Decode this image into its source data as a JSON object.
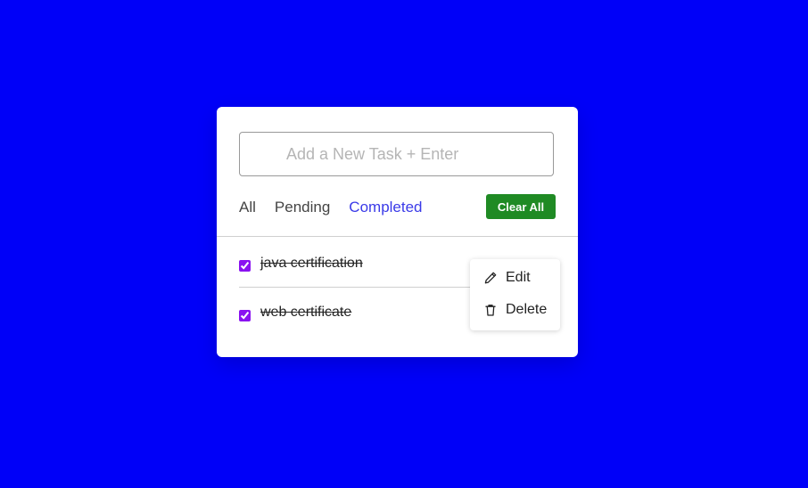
{
  "input": {
    "placeholder": "Add a New Task + Enter",
    "value": ""
  },
  "filters": {
    "items": [
      {
        "label": "All",
        "active": false
      },
      {
        "label": "Pending",
        "active": false
      },
      {
        "label": "Completed",
        "active": true
      }
    ]
  },
  "toolbar": {
    "clear_label": "Clear All"
  },
  "tasks": [
    {
      "label": "java certification",
      "checked": true
    },
    {
      "label": "web certificate",
      "checked": true
    }
  ],
  "menu": {
    "edit_label": "Edit",
    "edit_icon": "pencil-icon",
    "delete_label": "Delete",
    "delete_icon": "trash-icon"
  },
  "colors": {
    "background": "#0000f8",
    "accent": "#3a3ae8",
    "clear_button": "#1f8a24",
    "checkbox": "#8a12f0"
  }
}
